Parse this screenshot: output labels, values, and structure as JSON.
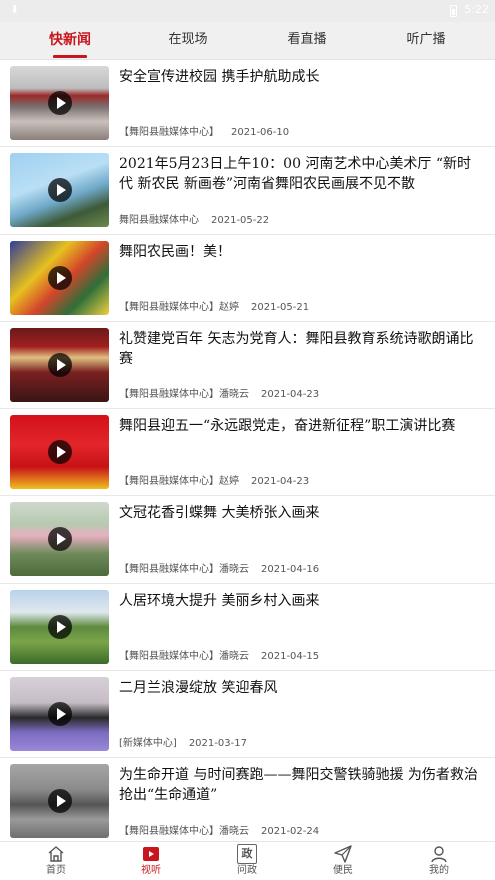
{
  "status_bar": {
    "download_glyph": "⬇",
    "time": "5:22"
  },
  "tabs": [
    {
      "label": "快新闻",
      "active": true
    },
    {
      "label": "在现场",
      "active": false
    },
    {
      "label": "看直播",
      "active": false
    },
    {
      "label": "听广播",
      "active": false
    }
  ],
  "news": [
    {
      "title": "安全宣传进校园 携手护航助成长",
      "source": "【舞阳县融媒体中心】",
      "date": "2021-06-10"
    },
    {
      "title": "2021年5月23日上午10：00 河南艺术中心美术厅 “新时代 新农民 新画卷”河南省舞阳农民画展不见不散",
      "source": "舞阳县融媒体中心",
      "date": "2021-05-22"
    },
    {
      "title": "舞阳农民画！美！",
      "source": "【舞阳县融媒体中心】赵婷",
      "date": "2021-05-21"
    },
    {
      "title": "礼赞建党百年 矢志为党育人：舞阳县教育系统诗歌朗诵比赛",
      "source": "【舞阳县融媒体中心】潘晓云",
      "date": "2021-04-23"
    },
    {
      "title": "舞阳县迎五一“永远跟党走，奋进新征程”职工演讲比赛",
      "source": "【舞阳县融媒体中心】赵婷",
      "date": "2021-04-23"
    },
    {
      "title": "文冠花香引蝶舞 大美桥张入画来",
      "source": "【舞阳县融媒体中心】潘晓云",
      "date": "2021-04-16"
    },
    {
      "title": "人居环境大提升 美丽乡村入画来",
      "source": "【舞阳县融媒体中心】潘晓云",
      "date": "2021-04-15"
    },
    {
      "title": "二月兰浪漫绽放 笑迎春风",
      "source": "[新媒体中心]",
      "date": "2021-03-17"
    },
    {
      "title": "为生命开道 与时间赛跑——舞阳交警铁骑驰援 为伤者救治抢出“生命通道”",
      "source": "【舞阳县融媒体中心】潘晓云",
      "date": "2021-02-24"
    }
  ],
  "bottom_nav": [
    {
      "label": "首页",
      "icon": "home-icon",
      "active": false
    },
    {
      "label": "视听",
      "icon": "video-icon",
      "active": true
    },
    {
      "label": "问政",
      "icon": "zheng-icon",
      "glyph": "政",
      "active": false
    },
    {
      "label": "便民",
      "icon": "send-icon",
      "active": false
    },
    {
      "label": "我的",
      "icon": "user-icon",
      "active": false
    }
  ],
  "colors": {
    "accent": "#c8161e",
    "tab_bg": "#f0f0f0"
  }
}
